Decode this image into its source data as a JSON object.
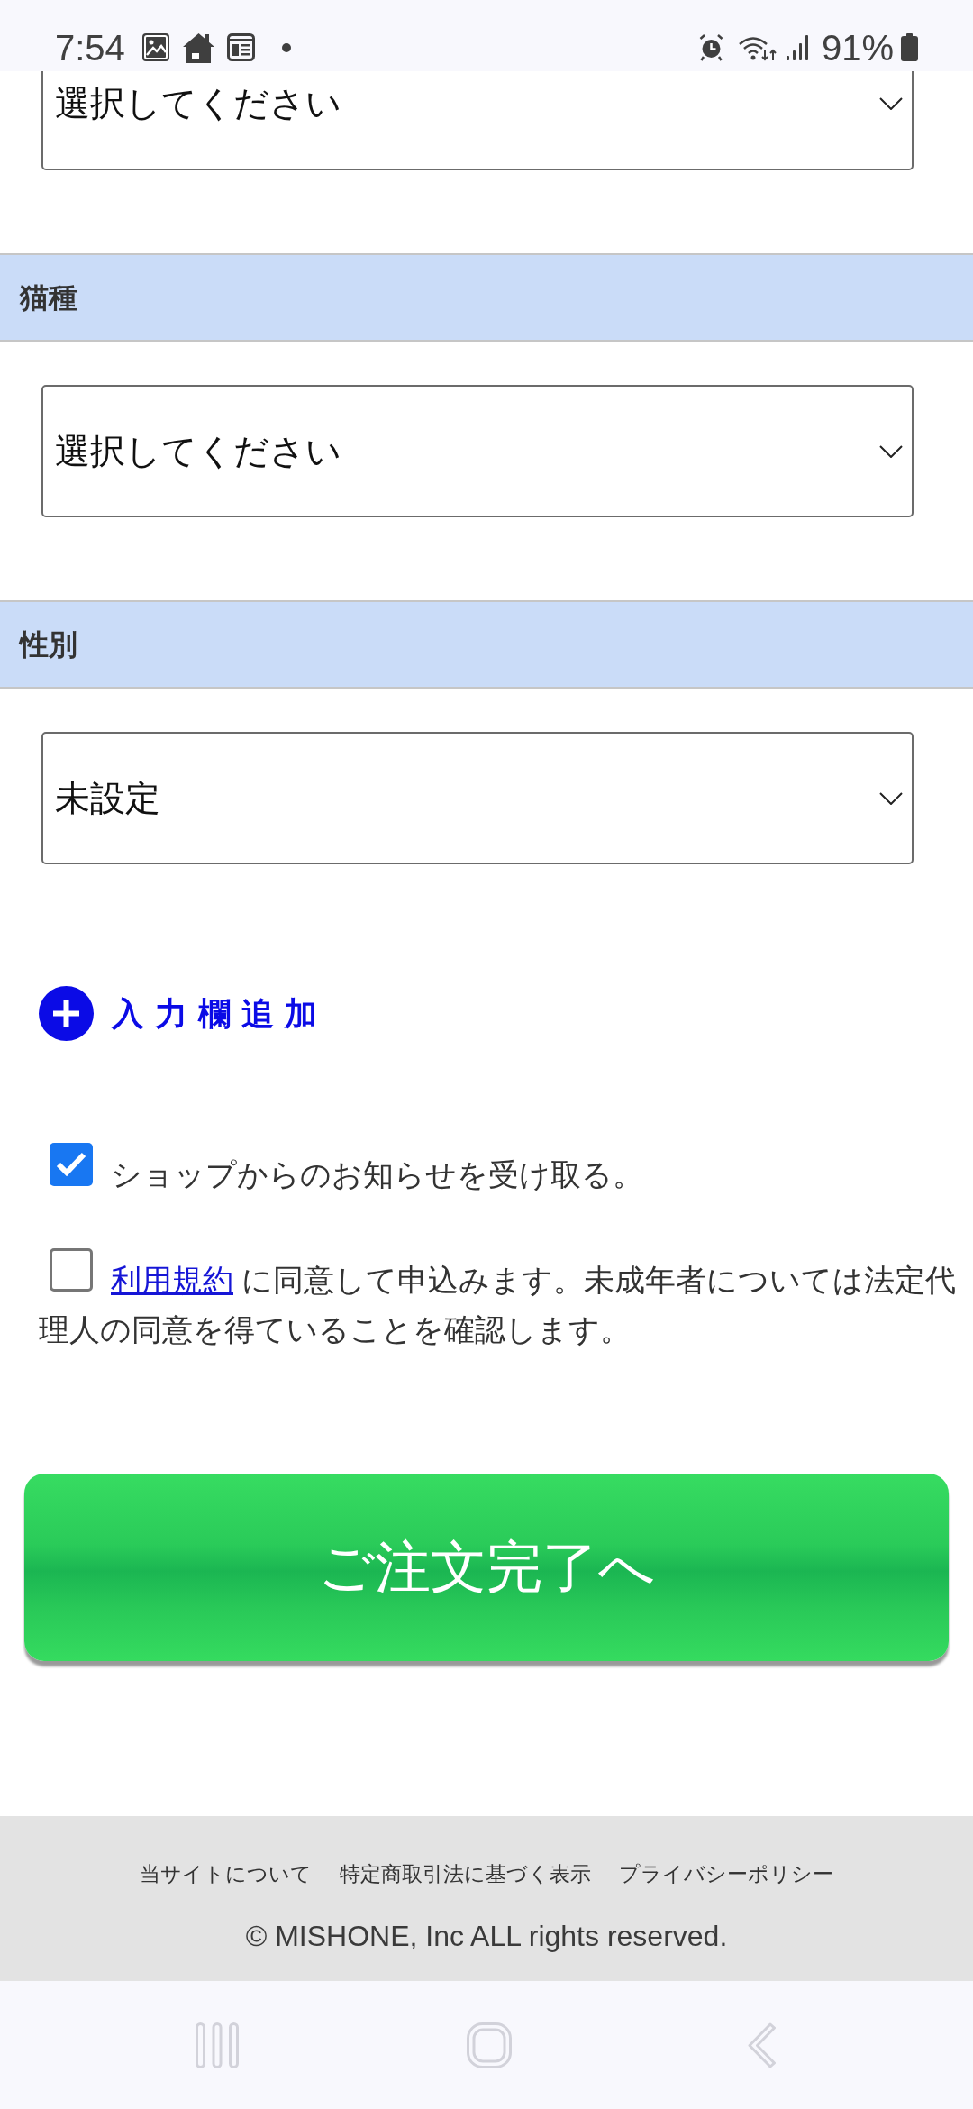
{
  "status_bar": {
    "time": "7:54",
    "battery": "91%"
  },
  "top_select": {
    "value": "選択してください"
  },
  "sections": [
    {
      "header": "猫種",
      "select": {
        "value": "選択してください"
      }
    },
    {
      "header": "性別",
      "select": {
        "value": "未設定"
      }
    }
  ],
  "add_field_button": {
    "label": "入力欄追加"
  },
  "consents": [
    {
      "checked": true,
      "text": "ショップからのお知らせを受け取る。"
    },
    {
      "checked": false,
      "link": "利用規約",
      "text": "に同意して申込みます。未成年者については法定代理人の同意を得ていることを確認します。"
    }
  ],
  "submit_button": {
    "label": "ご注文完了へ"
  },
  "footer": {
    "links": [
      "当サイトについて",
      "特定商取引法に基づく表示",
      "プライバシーポリシー"
    ],
    "copyright": "© MISHONE, Inc ALL rights reserved."
  }
}
